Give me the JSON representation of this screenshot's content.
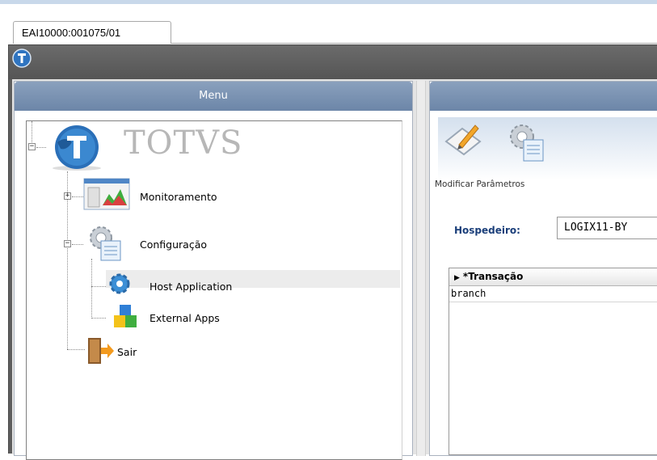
{
  "tab": {
    "label": "EAI10000:001075/01"
  },
  "menu_panel": {
    "title": "Menu"
  },
  "tree": {
    "root": {
      "label": "TOTVS",
      "expander": "−"
    },
    "items": [
      {
        "label": "Monitoramento",
        "expander": "+",
        "icon": "monitoring-chart-icon"
      },
      {
        "label": "Configuração",
        "expander": "−",
        "icon": "settings-gear-icon"
      },
      {
        "label": "Host Application",
        "icon": "gear-icon",
        "selected": true
      },
      {
        "label": "External Apps",
        "icon": "cubes-icon"
      },
      {
        "label": "Sair",
        "icon": "exit-door-icon"
      }
    ]
  },
  "toolbar": {
    "caption": "Modificar Parâmetros"
  },
  "form": {
    "hospedeiro_label": "Hospedeiro:",
    "hospedeiro_value": "LOGIX11-BY"
  },
  "grid": {
    "header": "*Transação",
    "rows": [
      "branch"
    ]
  },
  "colors": {
    "panel_header": "#7a91b0",
    "titlebar": "#5e5e5e",
    "label_blue": "#1b3f7a"
  }
}
